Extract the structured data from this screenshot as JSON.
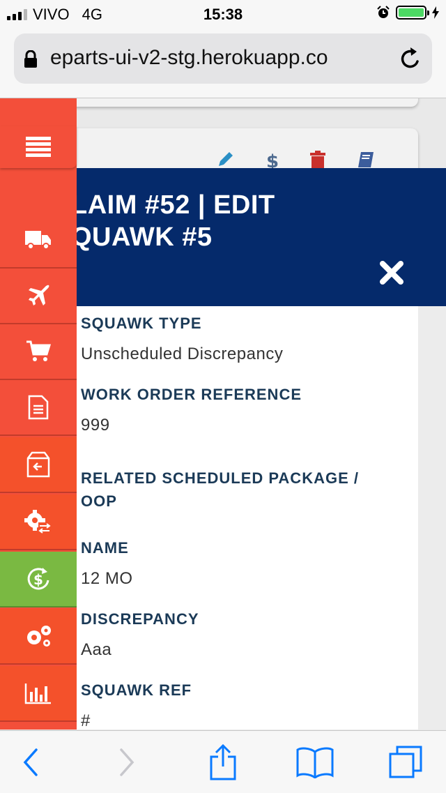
{
  "status_bar": {
    "carrier": "VIVO",
    "network": "4G",
    "time": "15:38"
  },
  "browser": {
    "url": "eparts-ui-v2-stg.herokuapp.co"
  },
  "modal": {
    "title_line1": "LAIM #52 | EDIT",
    "title_line2": "QUAWK #5",
    "fields": [
      {
        "label": "SQUAWK TYPE",
        "value": "Unscheduled Discrepancy"
      },
      {
        "label": "WORK ORDER REFERENCE",
        "value": "999"
      },
      {
        "label_line1": "RELATED SCHEDULED PACKAGE /",
        "label_line2": "OOP"
      },
      {
        "label": "NAME",
        "value": "12 MO"
      },
      {
        "label": "DISCREPANCY",
        "value": "Aaa"
      },
      {
        "label": "SQUAWK REF",
        "value": "#"
      }
    ]
  },
  "sidebar": {
    "items": [
      "menu-icon",
      "truck-icon",
      "plane-icon",
      "cart-icon",
      "document-icon",
      "return-box-icon",
      "gear-swap-icon",
      "dollar-refresh-icon",
      "gears-icon",
      "bar-chart-icon"
    ],
    "colors": {
      "primary": "#f34f3a",
      "active": "#7ab942",
      "header": "#052a6b"
    }
  },
  "background_toolbar": {
    "icons": [
      "pencil-icon",
      "dollar-icon",
      "trash-icon",
      "book-icon"
    ]
  },
  "bottom_bar": {
    "icons": [
      "back-icon",
      "forward-icon",
      "share-icon",
      "bookmarks-icon",
      "tabs-icon"
    ]
  }
}
